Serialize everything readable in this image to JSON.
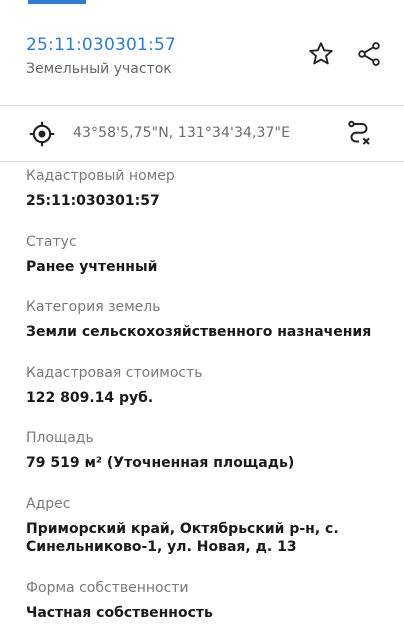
{
  "header": {
    "cadastral_number": "25:11:030301:57",
    "object_type": "Земельный участок",
    "icons": {
      "favorite": "star-outline-icon",
      "share": "share-icon"
    }
  },
  "coords_bar": {
    "coordinates": "43°58'5,75\"N, 131°34'34,37\"E",
    "icons": {
      "locate": "crosshair-icon",
      "route": "route-clear-icon"
    }
  },
  "fields": [
    {
      "label": "Кадастровый номер",
      "value": "25:11:030301:57"
    },
    {
      "label": "Статус",
      "value": "Ранее учтенный"
    },
    {
      "label": "Категория земель",
      "value": "Земли сельскохозяйственного назначения"
    },
    {
      "label": "Кадастровая стоимость",
      "value": "122 809.14 руб."
    },
    {
      "label": "Площадь",
      "value": "79 519 м² (Уточненная площадь)"
    },
    {
      "label": "Адрес",
      "value": "Приморский край, Октябрьский р-н, с. Синельниково-1, ул. Новая, д. 13"
    },
    {
      "label": "Форма собственности",
      "value": "Частная собственность"
    }
  ],
  "colors": {
    "accent": "#2f7bd1",
    "divider": "#d9d9d9",
    "label": "#7a7a7a"
  }
}
